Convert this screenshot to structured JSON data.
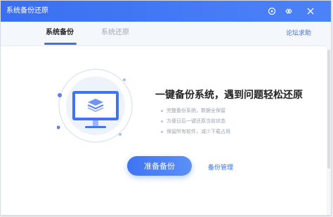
{
  "window": {
    "title": "系统备份还原"
  },
  "titlebar_icons": [
    "restore-icon",
    "settings-icon",
    "close-icon"
  ],
  "tabs": [
    {
      "label": "系统备份",
      "active": true
    },
    {
      "label": "系统还原",
      "active": false
    }
  ],
  "forum_link": "论坛求助",
  "headline": "一键备份系统，遇到问题轻松还原",
  "features": [
    "完整备份系统，数据全保留",
    "方便日后一键还原当前状态",
    "保留所有软件，减少下载占用"
  ],
  "primary_button": "准备备份",
  "manage_link": "备份管理",
  "colors": {
    "accent": "#3a6ff0",
    "titlebar": "#4c82f7"
  }
}
